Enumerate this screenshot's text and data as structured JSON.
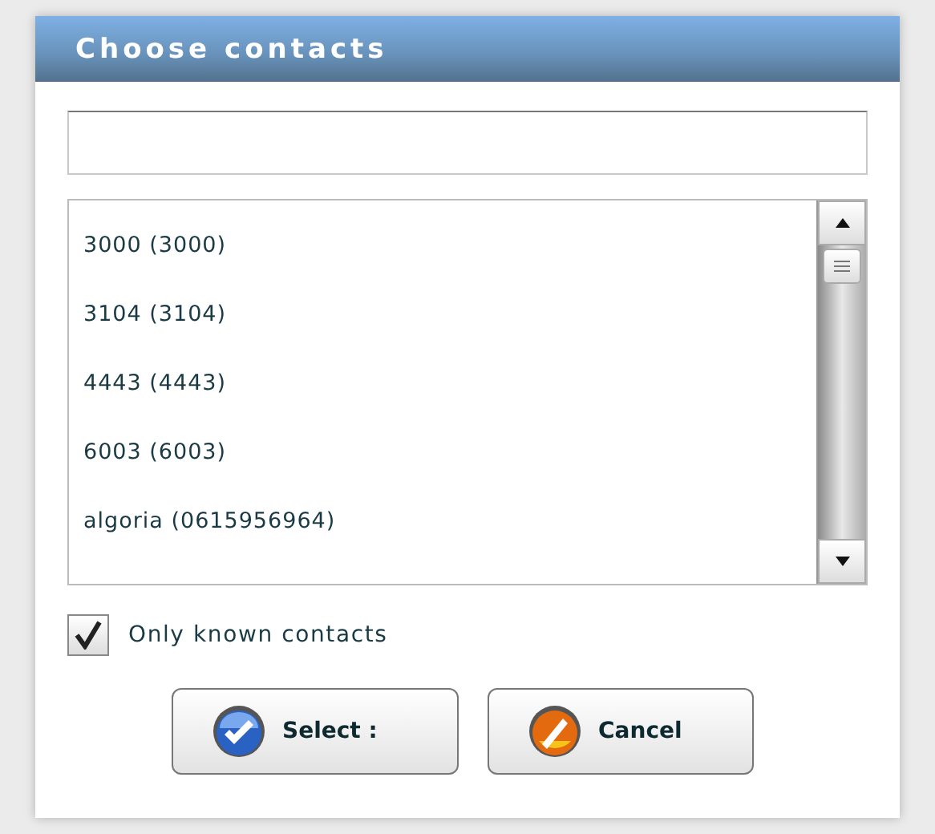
{
  "dialog": {
    "title": "Choose contacts"
  },
  "contacts": [
    {
      "label": "3000 (3000)",
      "selected": false
    },
    {
      "label": "3104 (3104)",
      "selected": false
    },
    {
      "label": "4443 (4443)",
      "selected": false
    },
    {
      "label": "6003 (6003)",
      "selected": false
    },
    {
      "label": "algoria (0615956964)",
      "selected": false
    }
  ],
  "only_known": {
    "label": "Only known contacts",
    "checked": true
  },
  "buttons": [
    {
      "kind": "select",
      "label": "Select :"
    },
    {
      "kind": "cancel",
      "label": "Cancel"
    }
  ]
}
